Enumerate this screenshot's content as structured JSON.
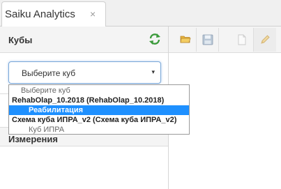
{
  "tab": {
    "title": "Saiku Analytics",
    "close_glyph": "×"
  },
  "cubes_panel": {
    "title": "Кубы",
    "refresh_icon": "refresh-icon",
    "select": {
      "value": "Выберите куб",
      "arrow": "▾"
    }
  },
  "dimensions_panel": {
    "title": "Измерения"
  },
  "toolbar": {
    "buttons": [
      {
        "icon": "folder-open-icon"
      },
      {
        "icon": "save-icon"
      },
      {
        "icon": "new-document-icon"
      },
      {
        "icon": "edit-pencil-icon"
      }
    ]
  },
  "dropdown": {
    "placeholder": "Выберите куб",
    "groups": [
      {
        "label": "RehabOlap_10.2018 (RehabOlap_10.2018)",
        "items": [
          {
            "label": "Реабилитация",
            "selected": true
          }
        ]
      },
      {
        "label": "Схема куба ИПРА_v2 (Схема куба ИПРА_v2)",
        "items": [
          {
            "label": "Куб ИПРА",
            "selected": false
          }
        ]
      }
    ]
  },
  "colors": {
    "selected_bg": "#1e90ff",
    "refresh_green": "#3a9a3a",
    "folder_yellow": "#e8b33c"
  }
}
